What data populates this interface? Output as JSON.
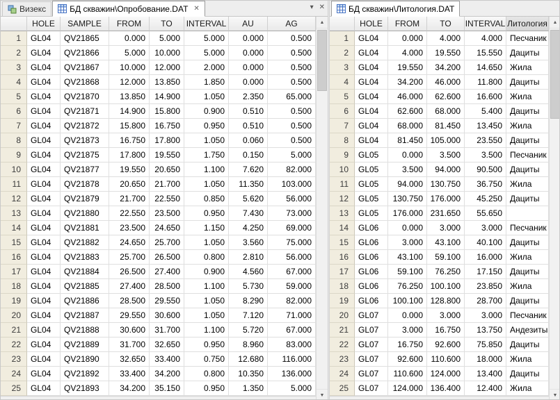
{
  "left_panel": {
    "tabs": [
      {
        "label": "Визекс",
        "active": false
      },
      {
        "label": "БД скважин\\Опробование.DAT",
        "active": true,
        "close": "✕"
      }
    ],
    "controls": {
      "menu": "▾",
      "close": "✕"
    },
    "table": {
      "columns": [
        "HOLE",
        "SAMPLE",
        "FROM",
        "TO",
        "INTERVAL",
        "AU",
        "AG"
      ],
      "rows": [
        [
          "GL04",
          "QV21865",
          "0.000",
          "5.000",
          "5.000",
          "0.000",
          "0.500"
        ],
        [
          "GL04",
          "QV21866",
          "5.000",
          "10.000",
          "5.000",
          "0.000",
          "0.500"
        ],
        [
          "GL04",
          "QV21867",
          "10.000",
          "12.000",
          "2.000",
          "0.000",
          "0.500"
        ],
        [
          "GL04",
          "QV21868",
          "12.000",
          "13.850",
          "1.850",
          "0.000",
          "0.500"
        ],
        [
          "GL04",
          "QV21870",
          "13.850",
          "14.900",
          "1.050",
          "2.350",
          "65.000"
        ],
        [
          "GL04",
          "QV21871",
          "14.900",
          "15.800",
          "0.900",
          "0.510",
          "0.500"
        ],
        [
          "GL04",
          "QV21872",
          "15.800",
          "16.750",
          "0.950",
          "0.510",
          "0.500"
        ],
        [
          "GL04",
          "QV21873",
          "16.750",
          "17.800",
          "1.050",
          "0.060",
          "0.500"
        ],
        [
          "GL04",
          "QV21875",
          "17.800",
          "19.550",
          "1.750",
          "0.150",
          "5.000"
        ],
        [
          "GL04",
          "QV21877",
          "19.550",
          "20.650",
          "1.100",
          "7.620",
          "82.000"
        ],
        [
          "GL04",
          "QV21878",
          "20.650",
          "21.700",
          "1.050",
          "11.350",
          "103.000"
        ],
        [
          "GL04",
          "QV21879",
          "21.700",
          "22.550",
          "0.850",
          "5.620",
          "56.000"
        ],
        [
          "GL04",
          "QV21880",
          "22.550",
          "23.500",
          "0.950",
          "7.430",
          "73.000"
        ],
        [
          "GL04",
          "QV21881",
          "23.500",
          "24.650",
          "1.150",
          "4.250",
          "69.000"
        ],
        [
          "GL04",
          "QV21882",
          "24.650",
          "25.700",
          "1.050",
          "3.560",
          "75.000"
        ],
        [
          "GL04",
          "QV21883",
          "25.700",
          "26.500",
          "0.800",
          "2.810",
          "56.000"
        ],
        [
          "GL04",
          "QV21884",
          "26.500",
          "27.400",
          "0.900",
          "4.560",
          "67.000"
        ],
        [
          "GL04",
          "QV21885",
          "27.400",
          "28.500",
          "1.100",
          "5.730",
          "59.000"
        ],
        [
          "GL04",
          "QV21886",
          "28.500",
          "29.550",
          "1.050",
          "8.290",
          "82.000"
        ],
        [
          "GL04",
          "QV21887",
          "29.550",
          "30.600",
          "1.050",
          "7.120",
          "71.000"
        ],
        [
          "GL04",
          "QV21888",
          "30.600",
          "31.700",
          "1.100",
          "5.720",
          "67.000"
        ],
        [
          "GL04",
          "QV21889",
          "31.700",
          "32.650",
          "0.950",
          "8.960",
          "83.000"
        ],
        [
          "GL04",
          "QV21890",
          "32.650",
          "33.400",
          "0.750",
          "12.680",
          "116.000"
        ],
        [
          "GL04",
          "QV21892",
          "33.400",
          "34.200",
          "0.800",
          "10.350",
          "136.000"
        ],
        [
          "GL04",
          "QV21893",
          "34.200",
          "35.150",
          "0.950",
          "1.350",
          "5.000"
        ]
      ]
    },
    "scrollbar": {
      "up": "▲",
      "down": "▼"
    }
  },
  "right_panel": {
    "tabs": [
      {
        "label": "БД скважин\\Литология.DAT",
        "active": true
      }
    ],
    "table": {
      "columns": [
        "HOLE",
        "FROM",
        "TO",
        "INTERVAL",
        "Литология"
      ],
      "rows": [
        [
          "GL04",
          "0.000",
          "4.000",
          "4.000",
          "Песчаник"
        ],
        [
          "GL04",
          "4.000",
          "19.550",
          "15.550",
          "Дациты"
        ],
        [
          "GL04",
          "19.550",
          "34.200",
          "14.650",
          "Жила"
        ],
        [
          "GL04",
          "34.200",
          "46.000",
          "11.800",
          "Дациты"
        ],
        [
          "GL04",
          "46.000",
          "62.600",
          "16.600",
          "Жила"
        ],
        [
          "GL04",
          "62.600",
          "68.000",
          "5.400",
          "Дациты"
        ],
        [
          "GL04",
          "68.000",
          "81.450",
          "13.450",
          "Жила"
        ],
        [
          "GL04",
          "81.450",
          "105.000",
          "23.550",
          "Дациты"
        ],
        [
          "GL05",
          "0.000",
          "3.500",
          "3.500",
          "Песчаник"
        ],
        [
          "GL05",
          "3.500",
          "94.000",
          "90.500",
          "Дациты"
        ],
        [
          "GL05",
          "94.000",
          "130.750",
          "36.750",
          "Жила"
        ],
        [
          "GL05",
          "130.750",
          "176.000",
          "45.250",
          "Дациты"
        ],
        [
          "GL05",
          "176.000",
          "231.650",
          "55.650",
          ""
        ],
        [
          "GL06",
          "0.000",
          "3.000",
          "3.000",
          "Песчаник"
        ],
        [
          "GL06",
          "3.000",
          "43.100",
          "40.100",
          "Дациты"
        ],
        [
          "GL06",
          "43.100",
          "59.100",
          "16.000",
          "Жила"
        ],
        [
          "GL06",
          "59.100",
          "76.250",
          "17.150",
          "Дациты"
        ],
        [
          "GL06",
          "76.250",
          "100.100",
          "23.850",
          "Жила"
        ],
        [
          "GL06",
          "100.100",
          "128.800",
          "28.700",
          "Дациты"
        ],
        [
          "GL07",
          "0.000",
          "3.000",
          "3.000",
          "Песчаник"
        ],
        [
          "GL07",
          "3.000",
          "16.750",
          "13.750",
          "Андезиты"
        ],
        [
          "GL07",
          "16.750",
          "92.600",
          "75.850",
          "Дациты"
        ],
        [
          "GL07",
          "92.600",
          "110.600",
          "18.000",
          "Жила"
        ],
        [
          "GL07",
          "110.600",
          "124.000",
          "13.400",
          "Дациты"
        ],
        [
          "GL07",
          "124.000",
          "136.400",
          "12.400",
          "Жила"
        ]
      ]
    },
    "scrollbar": {
      "up": "▲",
      "down": "▼"
    }
  }
}
